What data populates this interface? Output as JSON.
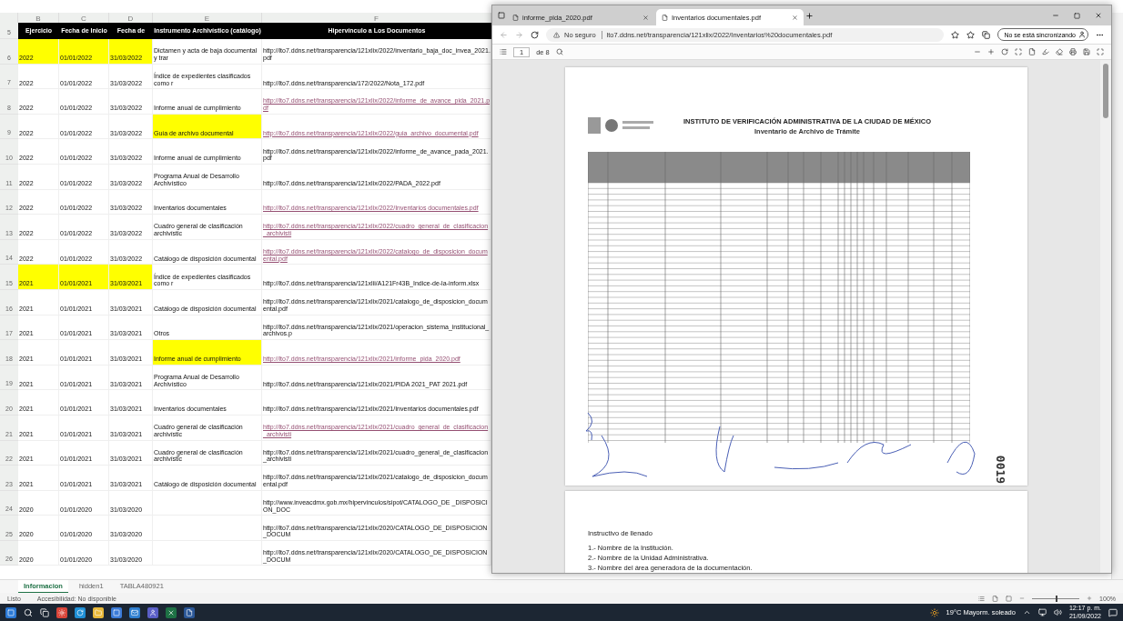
{
  "spreadsheet": {
    "column_letters": [
      "B",
      "C",
      "D",
      "E",
      "F"
    ],
    "header_row_number": "5",
    "headers": [
      "Ejercicio",
      "Fecha de Inicio",
      "Fecha de",
      "Instrumento Archivístico (catálogo)",
      "Hipervínculo a Los Documentos"
    ],
    "rows": [
      {
        "number": "6",
        "year": "2022",
        "start": "01/01/2022",
        "end": "31/03/2022",
        "instrument": "Dictamen y acta de baja documental y trar",
        "link": "http://lto7.ddns.net/transparencia/121xlix/2022/inventario_baja_doc_invea_2021.pdf",
        "hyperlink": false,
        "dates_highlighted": true,
        "instrument_highlighted": false
      },
      {
        "number": "7",
        "year": "2022",
        "start": "01/01/2022",
        "end": "31/03/2022",
        "instrument": "Índice de expedientes clasificados como r",
        "link": "http://lto7.ddns.net/transparencia/172/2022/Nota_172.pdf",
        "hyperlink": false,
        "dates_highlighted": false,
        "instrument_highlighted": false
      },
      {
        "number": "8",
        "year": "2022",
        "start": "01/01/2022",
        "end": "31/03/2022",
        "instrument": "Informe anual de cumplimiento",
        "link": "http://lto7.ddns.net/transparencia/121xlix/2022/informe_de_avance_pida_2021.pdf",
        "hyperlink": true,
        "dates_highlighted": false,
        "instrument_highlighted": false
      },
      {
        "number": "9",
        "year": "2022",
        "start": "01/01/2022",
        "end": "31/03/2022",
        "instrument": "Guía de archivo documental",
        "link": "http://lto7.ddns.net/transparencia/121xlix/2022/guia_archivo_documental.pdf",
        "hyperlink": true,
        "dates_highlighted": false,
        "instrument_highlighted": true
      },
      {
        "number": "10",
        "year": "2022",
        "start": "01/01/2022",
        "end": "31/03/2022",
        "instrument": "Informe anual de cumplimiento",
        "link": "http://lto7.ddns.net/transparencia/121xlix/2022/informe_de_avance_pada_2021.pdf",
        "hyperlink": false,
        "dates_highlighted": false,
        "instrument_highlighted": false
      },
      {
        "number": "11",
        "year": "2022",
        "start": "01/01/2022",
        "end": "31/03/2022",
        "instrument": "Programa Anual de Desarrollo Archivístico",
        "link": "http://lto7.ddns.net/transparencia/121xlix/2022/PADA_2022.pdf",
        "hyperlink": false,
        "dates_highlighted": false,
        "instrument_highlighted": false
      },
      {
        "number": "12",
        "year": "2022",
        "start": "01/01/2022",
        "end": "31/03/2022",
        "instrument": "Inventarios documentales",
        "link": "http://lto7.ddns.net/transparencia/121xlix/2022/Inventarios documentales.pdf",
        "hyperlink": true,
        "dates_highlighted": false,
        "instrument_highlighted": false
      },
      {
        "number": "13",
        "year": "2022",
        "start": "01/01/2022",
        "end": "31/03/2022",
        "instrument": "Cuadro general de clasificación archivístic",
        "link": "http://lto7.ddns.net/transparencia/121xlix/2022/cuadro_general_de_clasificacion_archivisti",
        "hyperlink": true,
        "dates_highlighted": false,
        "instrument_highlighted": false
      },
      {
        "number": "14",
        "year": "2022",
        "start": "01/01/2022",
        "end": "31/03/2022",
        "instrument": "Catálogo de disposición documental",
        "link": "http://lto7.ddns.net/transparencia/121xlix/2022/catalogo_de_disposicion_documental.pdf",
        "hyperlink": true,
        "dates_highlighted": false,
        "instrument_highlighted": false
      },
      {
        "number": "15",
        "year": "2021",
        "start": "01/01/2021",
        "end": "31/03/2021",
        "instrument": "Índice de expedientes clasificados como r",
        "link": "http://lto7.ddns.net/transparencia/121xlii/A121Fr43B_Indice-de-la-inform.xlsx",
        "hyperlink": false,
        "dates_highlighted": true,
        "instrument_highlighted": false
      },
      {
        "number": "16",
        "year": "2021",
        "start": "01/01/2021",
        "end": "31/03/2021",
        "instrument": "Catálogo de disposición documental",
        "link": "http://lto7.ddns.net/transparencia/121xlix/2021/catalogo_de_disposicion_documental.pdf",
        "hyperlink": false,
        "dates_highlighted": false,
        "instrument_highlighted": false
      },
      {
        "number": "17",
        "year": "2021",
        "start": "01/01/2021",
        "end": "31/03/2021",
        "instrument": "Otros",
        "link": "http://lto7.ddns.net/transparencia/121xlix/2021/operacion_sistema_institucional_archivos.p",
        "hyperlink": false,
        "dates_highlighted": false,
        "instrument_highlighted": false
      },
      {
        "number": "18",
        "year": "2021",
        "start": "01/01/2021",
        "end": "31/03/2021",
        "instrument": "Informe anual de cumplimiento",
        "link": "http://lto7.ddns.net/transparencia/121xlix/2021/informe_pida_2020.pdf",
        "hyperlink": true,
        "dates_highlighted": false,
        "instrument_highlighted": true
      },
      {
        "number": "19",
        "year": "2021",
        "start": "01/01/2021",
        "end": "31/03/2021",
        "instrument": "Programa Anual de Desarrollo Archivístico",
        "link": "http://lto7.ddns.net/transparencia/121xlix/2021/PIDA 2021_PAT 2021.pdf",
        "hyperlink": false,
        "dates_highlighted": false,
        "instrument_highlighted": false
      },
      {
        "number": "20",
        "year": "2021",
        "start": "01/01/2021",
        "end": "31/03/2021",
        "instrument": "Inventarios documentales",
        "link": "http://lto7.ddns.net/transparencia/121xlix/2021/Inventarios documentales.pdf",
        "hyperlink": false,
        "dates_highlighted": false,
        "instrument_highlighted": false
      },
      {
        "number": "21",
        "year": "2021",
        "start": "01/01/2021",
        "end": "31/03/2021",
        "instrument": "Cuadro general de clasificación archivístic",
        "link": "http://lto7.ddns.net/transparencia/121xlix/2021/cuadro_general_de_clasificacion_archivisti",
        "hyperlink": true,
        "dates_highlighted": false,
        "instrument_highlighted": false
      },
      {
        "number": "22",
        "year": "2021",
        "start": "01/01/2021",
        "end": "31/03/2021",
        "instrument": "Cuadro general de clasificación archivístic",
        "link": "http://lto7.ddns.net/transparencia/121xlix/2021/cuadro_general_de_clasificacion_archivisti",
        "hyperlink": false,
        "dates_highlighted": false,
        "instrument_highlighted": false
      },
      {
        "number": "23",
        "year": "2021",
        "start": "01/01/2021",
        "end": "31/03/2021",
        "instrument": "Catálogo de disposición documental",
        "link": "http://lto7.ddns.net/transparencia/121xlix/2021/catalogo_de_disposicion_documental.pdf",
        "hyperlink": false,
        "dates_highlighted": false,
        "instrument_highlighted": false
      },
      {
        "number": "24",
        "year": "2020",
        "start": "01/01/2020",
        "end": "31/03/2020",
        "link": "http://www.inveacdmx.gob.mx/hipervinculos/sipot/CATALOGO_DE _DISPOSICION_DOC",
        "hyperlink": false,
        "dates_highlighted": false,
        "instrument_highlighted": false
      },
      {
        "number": "25",
        "year": "2020",
        "start": "01/01/2020",
        "end": "31/03/2020",
        "link": "http://lto7.ddns.net/transparencia/121xlix/2020/CATALOGO_DE_DISPOSICION_DOCUM",
        "hyperlink": false,
        "dates_highlighted": false,
        "instrument_highlighted": false
      },
      {
        "number": "26",
        "year": "2020",
        "start": "01/01/2020",
        "end": "31/03/2020",
        "link": "http://lto7.ddns.net/transparencia/121xlix/2020/CATALOGO_DE_DISPOSICION_DOCUM",
        "hyperlink": false,
        "dates_highlighted": false,
        "instrument_highlighted": false
      }
    ],
    "sheet_tabs": [
      {
        "label": "Informacion",
        "selected": true
      },
      {
        "label": "hidden1",
        "selected": false
      },
      {
        "label": "TABLA480921",
        "selected": false
      }
    ],
    "status": "Listo",
    "accessibility": "Accesibilidad: No disponible",
    "zoom": "100%",
    "zoom_slider": {
      "level": 0.5
    }
  },
  "browser": {
    "tabs": [
      {
        "label": "informe_pida_2020.pdf",
        "selected": false
      },
      {
        "label": "Inventarios documentales.pdf",
        "selected": true
      }
    ],
    "security": "No seguro",
    "url": "lto7.ddns.net/transparencia/121xlix/2022/Inventarios%20documentales.pdf",
    "sync_button": "No se está sincronizando",
    "pdf_toolbar": {
      "page": "1",
      "page_count": "de 8"
    },
    "document": {
      "title": "INSTITUTO DE VERIFICACIÓN ADMINISTRATIVA DE LA CIUDAD DE MÉXICO",
      "subtitle": "Inventario de Archivo de Trámite",
      "stamp": "0019",
      "instructions_title": "Instructivo de llenado",
      "instructions": [
        "1.- Nombre de la Institución.",
        "2.- Nombre de la Unidad Administrativa.",
        "3.- Nombre del área generadora de la documentación."
      ]
    }
  },
  "taskbar": {
    "weather": "19°C Mayorm. soleado",
    "time": "12:17 p. m.",
    "date": "21/09/2022"
  }
}
